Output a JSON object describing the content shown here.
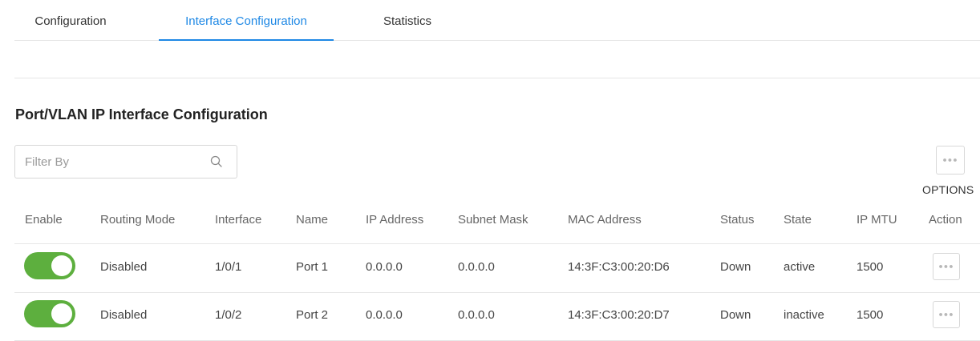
{
  "tabs": [
    {
      "label": "Configuration"
    },
    {
      "label": "Interface Configuration",
      "active": true
    },
    {
      "label": "Statistics"
    }
  ],
  "section_title": "Port/VLAN IP Interface Configuration",
  "filter": {
    "placeholder": "Filter By",
    "value": ""
  },
  "options_label": "OPTIONS",
  "accent_color": "#1e88e5",
  "toggle_on_color": "#5daf3e",
  "columns": [
    "Enable",
    "Routing Mode",
    "Interface",
    "Name",
    "IP Address",
    "Subnet Mask",
    "MAC Address",
    "Status",
    "State",
    "IP MTU",
    "Action"
  ],
  "rows": [
    {
      "enabled": true,
      "routing_mode": "Disabled",
      "interface": "1/0/1",
      "name": "Port 1",
      "ip": "0.0.0.0",
      "mask": "0.0.0.0",
      "mac": "14:3F:C3:00:20:D6",
      "status": "Down",
      "state": "active",
      "mtu": "1500"
    },
    {
      "enabled": true,
      "routing_mode": "Disabled",
      "interface": "1/0/2",
      "name": "Port 2",
      "ip": "0.0.0.0",
      "mask": "0.0.0.0",
      "mac": "14:3F:C3:00:20:D7",
      "status": "Down",
      "state": "inactive",
      "mtu": "1500"
    }
  ]
}
